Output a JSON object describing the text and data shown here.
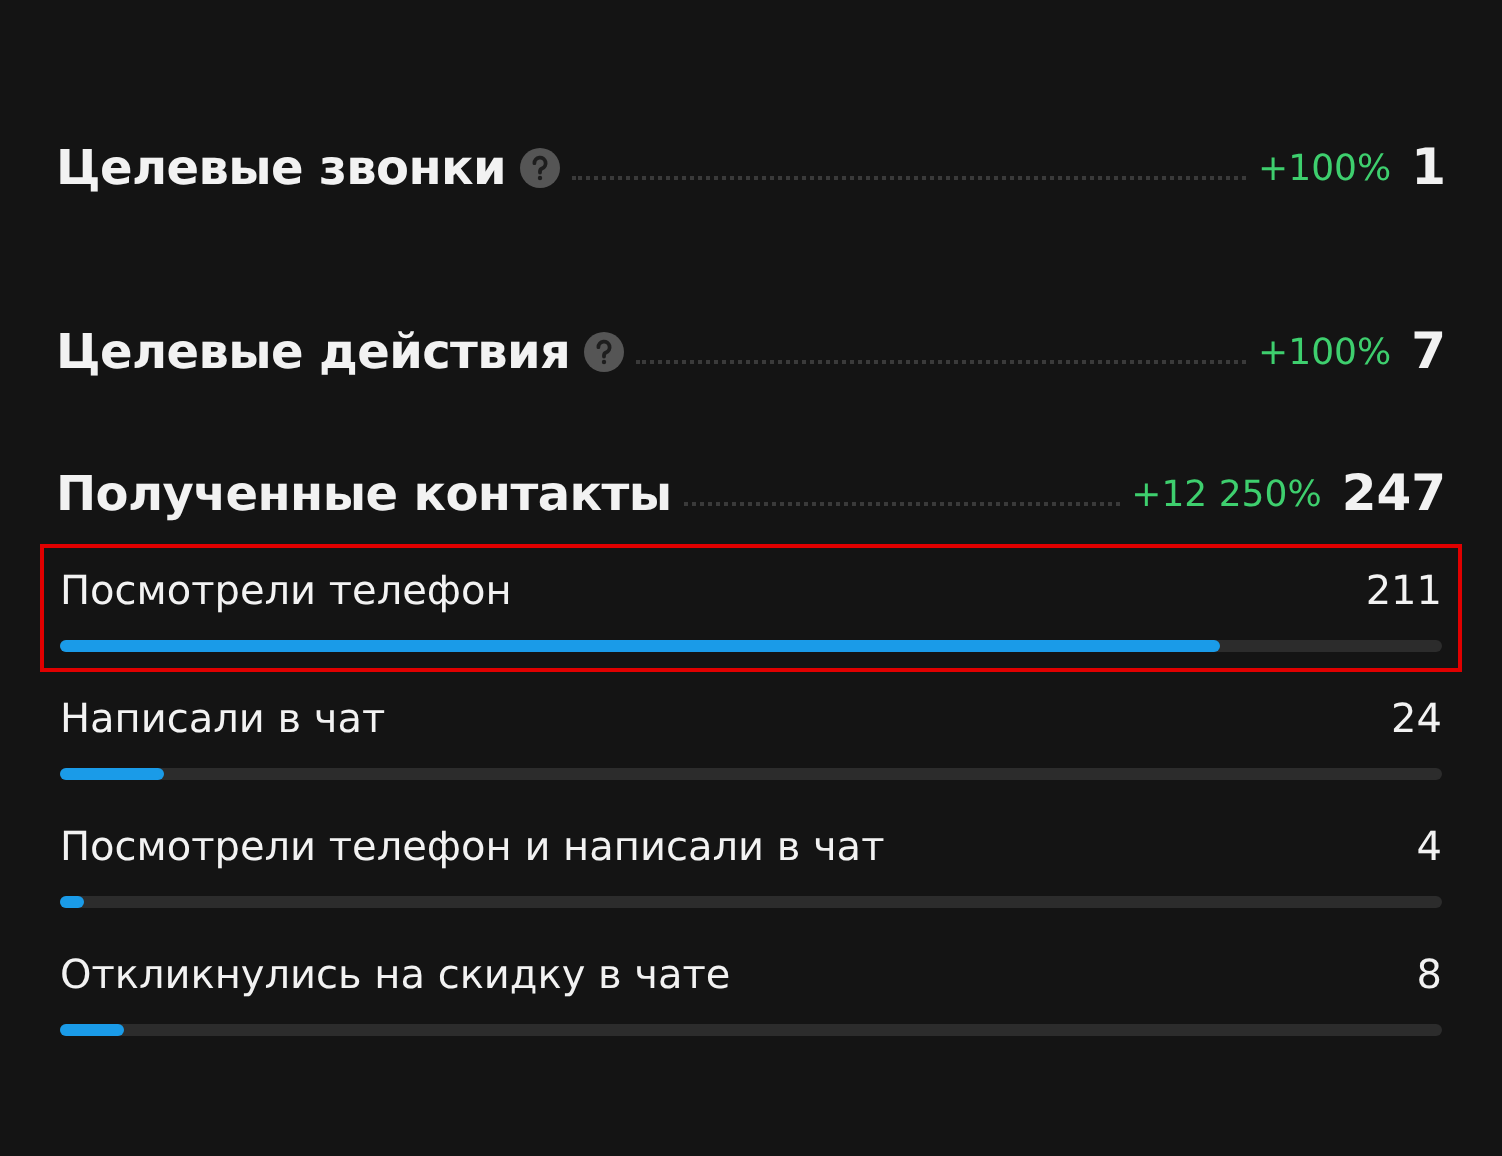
{
  "metrics": [
    {
      "title": "Целевые звонки",
      "help": true,
      "change": "+100%",
      "value": "1"
    },
    {
      "title": "Целевые действия",
      "help": true,
      "change": "+100%",
      "value": "7"
    },
    {
      "title": "Полученные контакты",
      "help": false,
      "change": "+12 250%",
      "value": "247"
    }
  ],
  "breakdown": [
    {
      "label": "Посмотрели телефон",
      "value": "211",
      "level": 0.84,
      "highlighted": true
    },
    {
      "label": "Написали в чат",
      "value": "24",
      "level": 0.075,
      "highlighted": false
    },
    {
      "label": "Посмотрели телефон и написали в чат",
      "value": "4",
      "level": 0.017,
      "highlighted": false
    },
    {
      "label": "Откликнулись на скидку в чате",
      "value": "8",
      "level": 0.046,
      "highlighted": false
    }
  ]
}
